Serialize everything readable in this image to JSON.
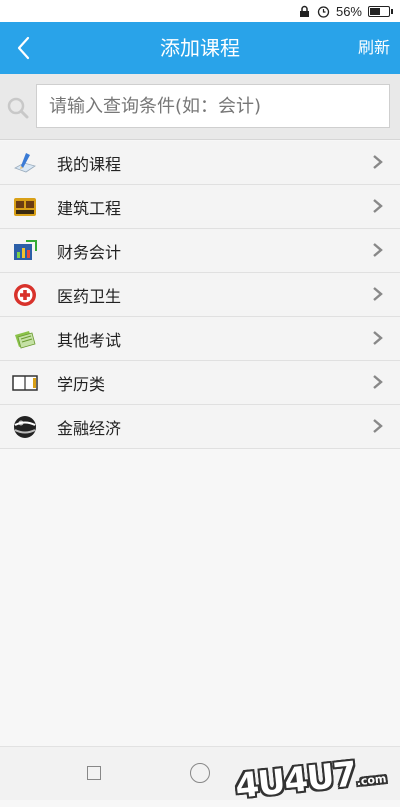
{
  "status_bar": {
    "battery_percent": "56%",
    "battery_level": 0.56
  },
  "header": {
    "title": "添加课程",
    "refresh_label": "刷新"
  },
  "search": {
    "placeholder": "请输入查询条件(如：会计)",
    "value": ""
  },
  "course_list": {
    "items": [
      {
        "label": "我的课程",
        "icon": "pencil-paper-icon"
      },
      {
        "label": "建筑工程",
        "icon": "construction-icon"
      },
      {
        "label": "财务会计",
        "icon": "finance-chart-icon"
      },
      {
        "label": "医药卫生",
        "icon": "medical-cross-icon"
      },
      {
        "label": "其他考试",
        "icon": "documents-icon"
      },
      {
        "label": "学历类",
        "icon": "book-icon"
      },
      {
        "label": "金融经济",
        "icon": "globe-icon"
      }
    ]
  },
  "watermark": {
    "text": "4U4U7",
    "suffix": ".com"
  },
  "colors": {
    "header": "#29a3e9",
    "background": "#f7f7f7"
  }
}
